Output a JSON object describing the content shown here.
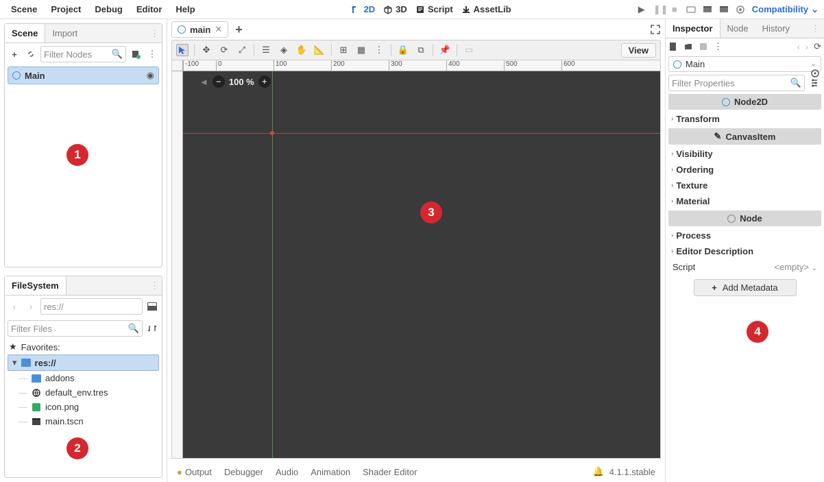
{
  "menus": [
    "Scene",
    "Project",
    "Debug",
    "Editor",
    "Help"
  ],
  "workspaces": {
    "d2": "2D",
    "d3": "3D",
    "script": "Script",
    "asset": "AssetLib"
  },
  "renderer": "Compatibility",
  "scene_dock": {
    "tabs": [
      "Scene",
      "Import"
    ],
    "filter_placeholder": "Filter Nodes",
    "root": "Main"
  },
  "fs_dock": {
    "title": "FileSystem",
    "path": "res://",
    "filter_placeholder": "Filter Files",
    "favorites": "Favorites:",
    "root": "res://",
    "items": [
      "addons",
      "default_env.tres",
      "icon.png",
      "main.tscn"
    ]
  },
  "editor": {
    "open_scene": "main",
    "view_btn": "View",
    "zoom": "100 %",
    "ruler": [
      "-100",
      "0",
      "100",
      "200",
      "300",
      "400",
      "500",
      "600"
    ]
  },
  "bottom": {
    "panels": [
      "Output",
      "Debugger",
      "Audio",
      "Animation",
      "Shader Editor"
    ],
    "version": "4.1.1.stable"
  },
  "inspector": {
    "tabs": [
      "Inspector",
      "Node",
      "History"
    ],
    "object": "Main",
    "filter_placeholder": "Filter Properties",
    "section_node2d": "Node2D",
    "prop_transform": "Transform",
    "section_canvasitem": "CanvasItem",
    "props_ci": [
      "Visibility",
      "Ordering",
      "Texture",
      "Material"
    ],
    "section_node": "Node",
    "props_node": [
      "Process",
      "Editor Description"
    ],
    "script_label": "Script",
    "script_value": "<empty>",
    "add_meta": "Add Metadata"
  },
  "badges": [
    "1",
    "2",
    "3",
    "4"
  ]
}
